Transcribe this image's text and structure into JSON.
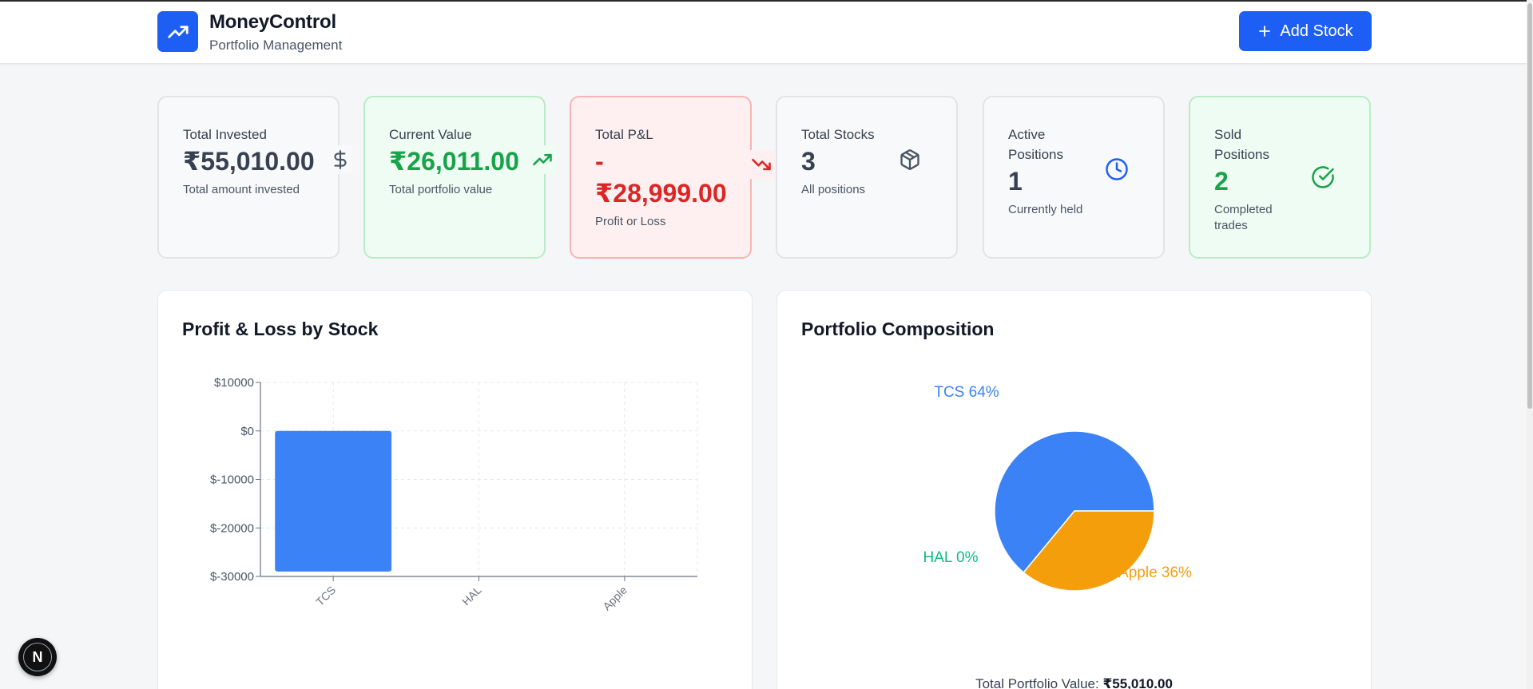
{
  "header": {
    "title": "MoneyControl",
    "subtitle": "Portfolio Management",
    "add_button_label": "Add Stock"
  },
  "stats": {
    "total_invested": {
      "label": "Total Invested",
      "value": "₹55,010.00",
      "desc": "Total amount invested",
      "icon": "dollar-icon"
    },
    "current_value": {
      "label": "Current Value",
      "value": "₹26,011.00",
      "desc": "Total portfolio value",
      "icon": "trending-up-icon"
    },
    "total_pl": {
      "label": "Total P&L",
      "value_line1": "-",
      "value_line2": "₹28,999.00",
      "desc": "Profit or Loss",
      "icon": "trending-down-icon"
    },
    "total_stocks": {
      "label": "Total Stocks",
      "value": "3",
      "desc": "All positions",
      "icon": "package-icon"
    },
    "active_positions": {
      "label_line1": "Active",
      "label_line2": "Positions",
      "value": "1",
      "desc": "Currently held",
      "icon": "clock-icon"
    },
    "sold_positions": {
      "label_line1": "Sold",
      "label_line2": "Positions",
      "value": "2",
      "desc_line1": "Completed",
      "desc_line2": "trades",
      "icon": "check-circle-icon"
    }
  },
  "charts": {
    "pl_title": "Profit & Loss by Stock",
    "composition_title": "Portfolio Composition",
    "total_label": "Total Portfolio Value:",
    "total_value": "₹55,010.00"
  },
  "colors": {
    "primary": "#1d5ff5",
    "bar": "#3b82f6",
    "tcs": "#3b82f6",
    "hal": "#10b981",
    "apple": "#f59e0b",
    "green": "#16a34a",
    "red": "#dc2626"
  },
  "chart_data": [
    {
      "type": "bar",
      "title": "Profit & Loss by Stock",
      "categories": [
        "TCS",
        "HAL",
        "Apple"
      ],
      "values": [
        -29000,
        0,
        0
      ],
      "ylim": [
        -30000,
        10000
      ],
      "yticks": [
        10000,
        0,
        -10000,
        -20000,
        -30000
      ],
      "ytick_labels": [
        "$10000",
        "$0",
        "$-10000",
        "$-20000",
        "$-30000"
      ],
      "grid": true
    },
    {
      "type": "pie",
      "title": "Portfolio Composition",
      "categories": [
        "TCS",
        "HAL",
        "Apple"
      ],
      "values": [
        64,
        0,
        36
      ],
      "labels": [
        "TCS 64%",
        "HAL 0%",
        "Apple 36%"
      ]
    }
  ]
}
